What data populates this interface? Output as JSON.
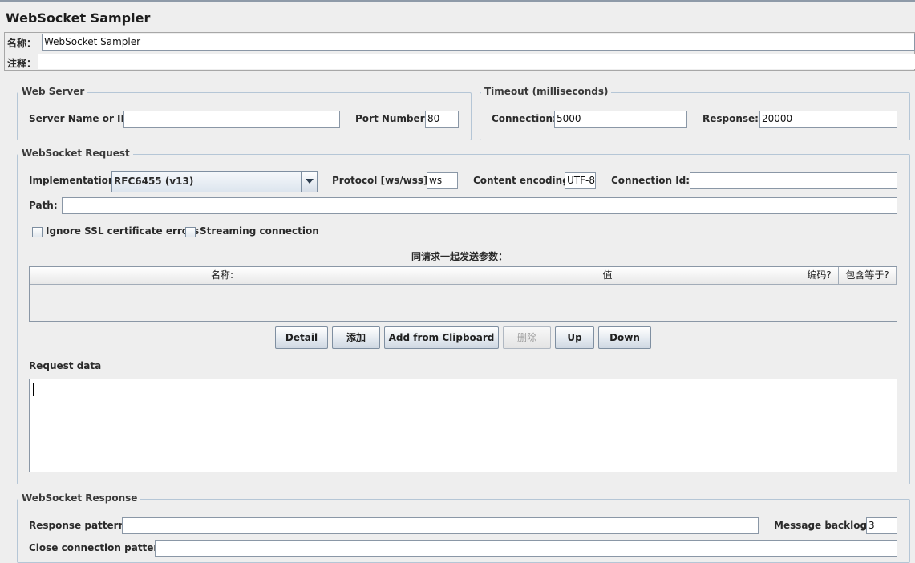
{
  "header": {
    "title": "WebSocket Sampler",
    "name_label": "名称：",
    "name_value": "WebSocket Sampler",
    "comment_label": "注释：",
    "comment_value": ""
  },
  "web_server": {
    "title": "Web Server",
    "server_label": "Server Name or IP:",
    "server_value": "",
    "port_label": "Port Number:",
    "port_value": "80"
  },
  "timeout": {
    "title": "Timeout (milliseconds)",
    "connection_label": "Connection:",
    "connection_value": "5000",
    "response_label": "Response:",
    "response_value": "20000"
  },
  "request": {
    "title": "WebSocket Request",
    "implementation_label": "Implementation:",
    "implementation_value": "RFC6455 (v13)",
    "protocol_label": "Protocol [ws/wss]:",
    "protocol_value": "ws",
    "encoding_label": "Content encoding:",
    "encoding_value": "UTF-8",
    "connid_label": "Connection Id:",
    "connid_value": "",
    "path_label": "Path:",
    "path_value": "",
    "ignore_ssl_label": "Ignore SSL certificate errors",
    "ignore_ssl_checked": false,
    "streaming_label": "Streaming connection",
    "streaming_checked": false,
    "params_title": "同请求一起发送参数：",
    "params_columns": [
      "名称:",
      "值",
      "编码?",
      "包含等于?"
    ],
    "buttons": {
      "detail": "Detail",
      "add": "添加",
      "add_clipboard": "Add from Clipboard",
      "delete": "删除",
      "up": "Up",
      "down": "Down"
    },
    "request_data_label": "Request data",
    "request_data_value": ""
  },
  "response": {
    "title": "WebSocket Response",
    "pattern_label": "Response pattern:",
    "pattern_value": "",
    "backlog_label": "Message backlog:",
    "backlog_value": "3",
    "close_label": "Close connection pattern:",
    "close_value": ""
  },
  "colors": {
    "background": "#eeeeee",
    "group_border": "#b5c6d6",
    "combo_selected_bg": "#dde5ee"
  }
}
